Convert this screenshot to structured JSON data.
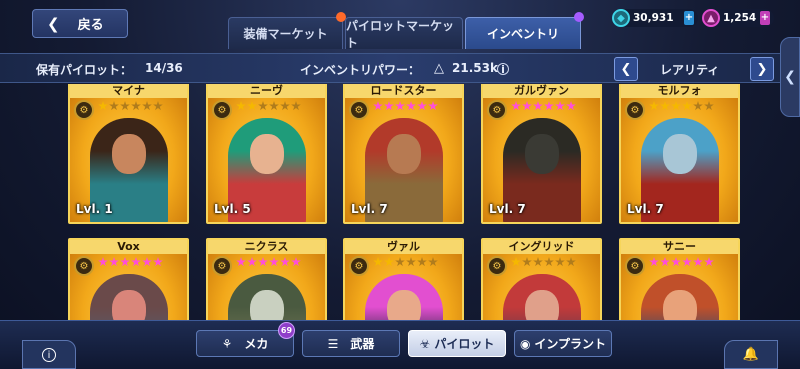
{
  "header": {
    "back_label": "戻る",
    "tabs": [
      {
        "label": "装備マーケット",
        "dot_color": "#ff6a2a"
      },
      {
        "label": "パイロットマーケット"
      },
      {
        "label": "インベントリ",
        "dot_color": "#a45cff",
        "active": true
      }
    ],
    "currency": [
      {
        "icon": "crystal-icon",
        "value": "30,931",
        "color": "#3fd5e8"
      },
      {
        "icon": "gem-icon",
        "value": "1,254",
        "color": "#e24fd0"
      }
    ]
  },
  "info": {
    "owned_label": "保有パイロット：",
    "owned_value": "14/36",
    "power_label": "インベントリパワー：",
    "power_value": "21.53k",
    "sort_label": "レアリティ"
  },
  "pilots": [
    {
      "name": "マイナ",
      "stars": 1,
      "star_color": "#f5b800",
      "level": "Lvl. 1",
      "hair": "#3b2518",
      "skin": "#c8865e",
      "suit": "#2a7f86"
    },
    {
      "name": "ニーヴ",
      "stars": 2,
      "star_color": "#f5b800",
      "level": "Lvl. 5",
      "hair": "#1f9c7a",
      "skin": "#e7b290",
      "suit": "#c83c3c"
    },
    {
      "name": "ロードスター",
      "stars": 6,
      "star_color": "#ff4fd8",
      "level": "Lvl. 7",
      "hair": "#b23a2a",
      "skin": "#b77a52",
      "suit": "#8a6a3a"
    },
    {
      "name": "ガルヴァン",
      "stars": 6,
      "star_color": "#ff4fd8",
      "level": "Lvl. 7",
      "hair": "#2b2a24",
      "skin": "#3a3a34",
      "suit": "#7a2a1e"
    },
    {
      "name": "モルフォ",
      "stars": 4,
      "star_color": "#f5b800",
      "level": "Lvl. 7",
      "hair": "#4ca1c8",
      "skin": "#a8c6d6",
      "suit": "#a3261e"
    },
    {
      "name": "Vox",
      "stars": 6,
      "star_color": "#ff4fd8",
      "level": "",
      "hair": "#6a4a4a",
      "skin": "#d9857a",
      "suit": "#5a5a68"
    },
    {
      "name": "ニクラス",
      "stars": 6,
      "star_color": "#ff4fd8",
      "level": "",
      "hair": "#4a5a40",
      "skin": "#c9d0c0",
      "suit": "#6a6f50"
    },
    {
      "name": "ヴァル",
      "stars": 2,
      "star_color": "#f5b800",
      "level": "",
      "hair": "#e24fd0",
      "skin": "#e8a98a",
      "suit": "#3a2a4a"
    },
    {
      "name": "イングリッド",
      "stars": 1,
      "star_color": "#f5b800",
      "level": "",
      "hair": "#c23a3a",
      "skin": "#e0a08a",
      "suit": "#6a3a4a"
    },
    {
      "name": "サニー",
      "stars": 6,
      "star_color": "#ff4fd8",
      "level": "",
      "hair": "#c0502a",
      "skin": "#e8a27a",
      "suit": "#3a4a6a"
    }
  ],
  "bottom": {
    "tabs": [
      {
        "icon": "mech-icon",
        "label": "メカ",
        "badge": "69"
      },
      {
        "icon": "weapon-icon",
        "label": "武器"
      },
      {
        "icon": "pilot-icon",
        "label": "パイロット",
        "active": true
      },
      {
        "icon": "implant-icon",
        "label": "インプラント"
      }
    ],
    "info_icon": "info-icon",
    "notify_icon": "notification-icon"
  }
}
